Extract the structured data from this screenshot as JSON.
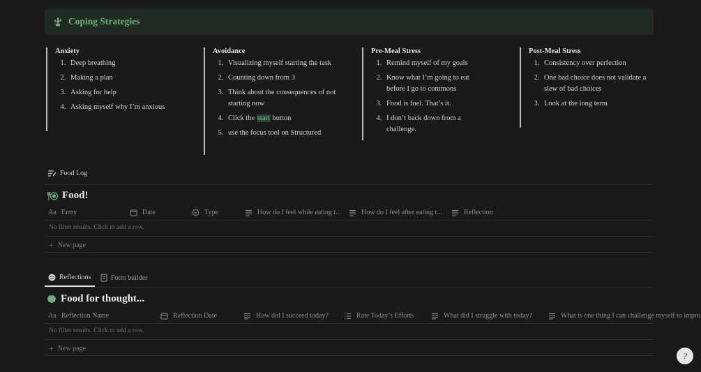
{
  "callout": {
    "title": "Coping Strategies",
    "icon": "cactus-icon"
  },
  "strategies": [
    {
      "heading": "Anxiety",
      "items": [
        "Deep breathing",
        "Making a plan",
        "Asking for help",
        "Asking myself why I’m anxious"
      ]
    },
    {
      "heading": "Avoidance",
      "items": [
        "Visualizing myself starting the task",
        "Counting down from 3",
        "Think about the consequences of not starting now",
        "use the focus tool on Structured"
      ],
      "click_item": {
        "before": "Click the ",
        "highlight": "start",
        "after": " button"
      }
    },
    {
      "heading": "Pre-Meal Stress",
      "items": [
        "Remind myself of my goals",
        "Know what I’m going to eat before I go to commons",
        "Food is fuel. That’s it.",
        "I don’t back down from a challenge."
      ]
    },
    {
      "heading": "Post-Meal Stress",
      "items": [
        "Consistency over perfection",
        "One bad choice does not validate a slew of bad choices",
        "Look at the long term"
      ]
    }
  ],
  "food_db": {
    "view_tab": "Food Log",
    "title": "Food!",
    "columns": [
      "Entry",
      "Date",
      "Type",
      "How do I feel while eating t...",
      "How do I feel after eating t...",
      "Reflection"
    ],
    "empty_text": "No filter results. Click to add a row.",
    "new_page": "New page"
  },
  "thought_db": {
    "tabs": [
      "Reflections",
      "Form builder"
    ],
    "title": "Food for thought...",
    "columns": [
      "Reflection Name",
      "Reflection Date",
      "How did I succeed today?",
      "Rate Today’s Efforts",
      "What did I struggle with today?",
      "What is one thing I can challenge myself to impro"
    ],
    "empty_text": "No filter results. Click to add a row.",
    "new_page": "New page"
  },
  "help_button": "?",
  "colors": {
    "background": "#191919",
    "callout_bg": "#1f2a22",
    "accent_green": "#6fae7e"
  }
}
